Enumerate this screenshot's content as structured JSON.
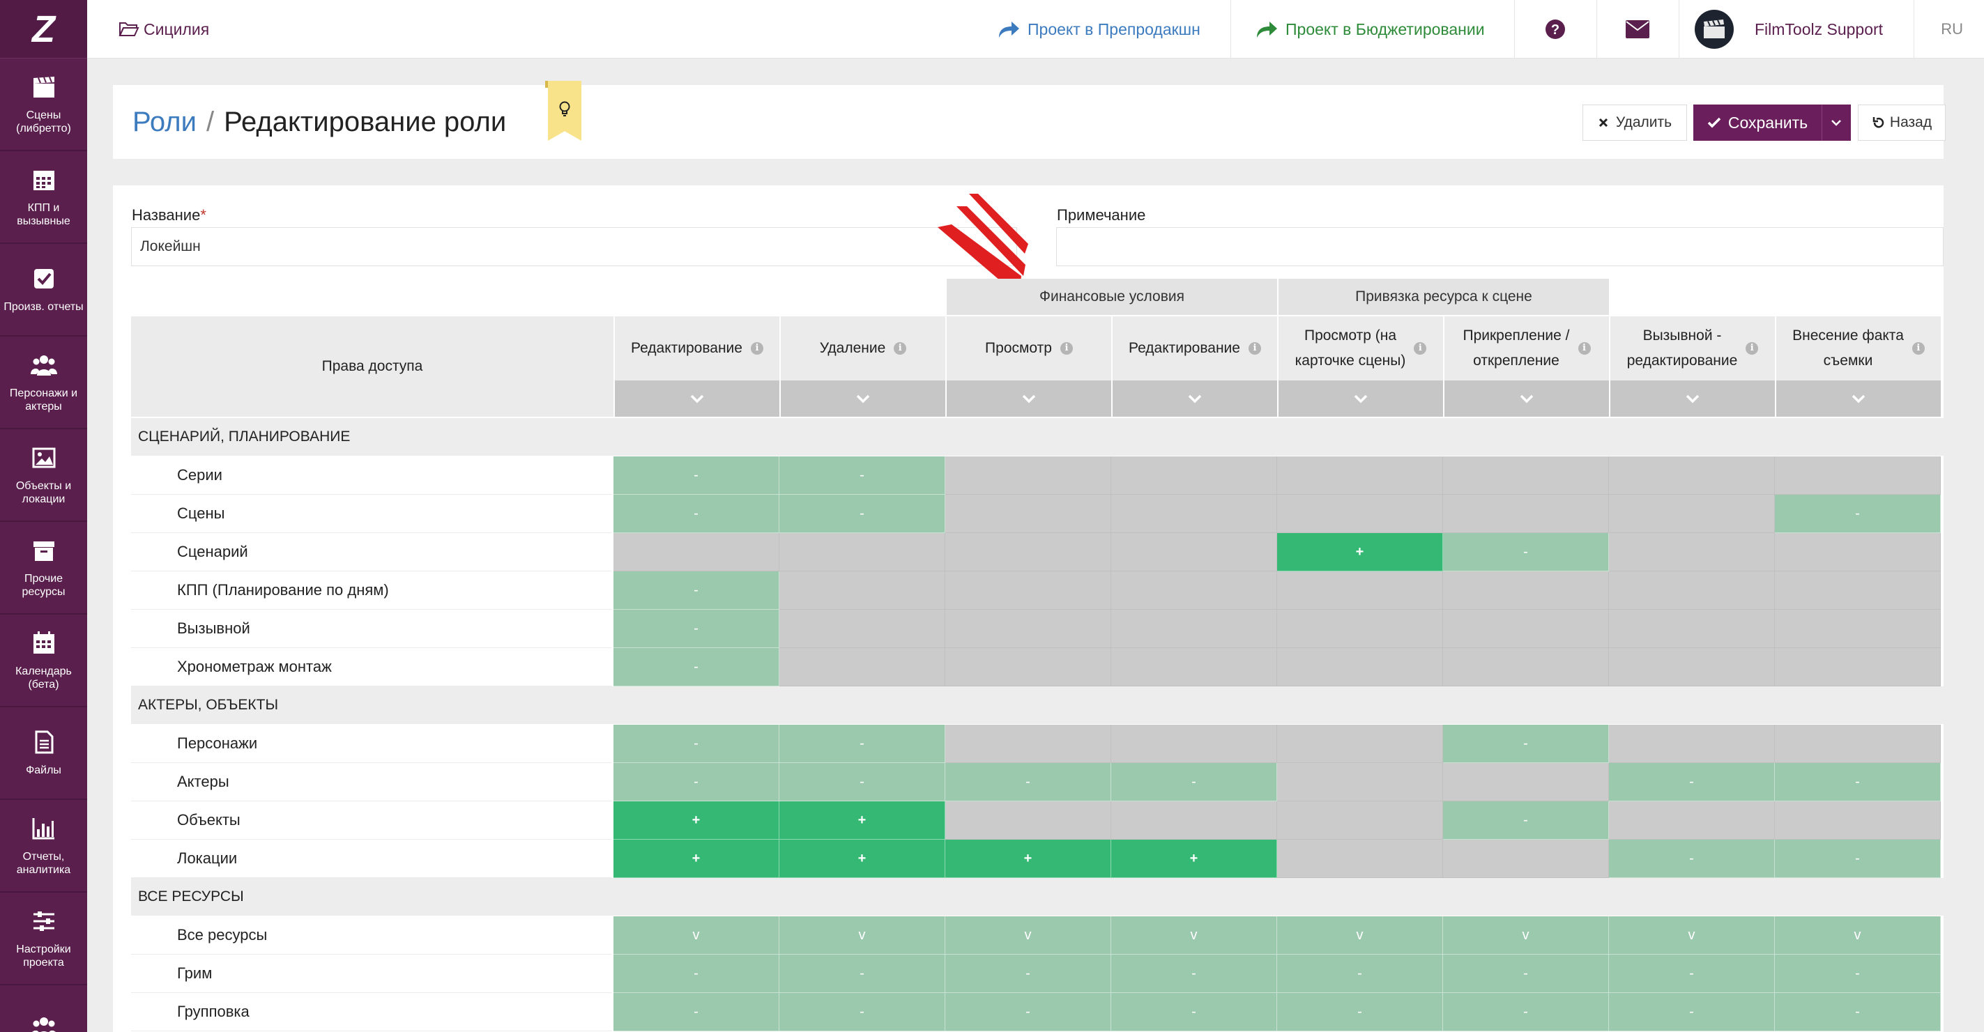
{
  "app": {
    "logo": "Z",
    "project_name": "Сицилия",
    "lang": "RU"
  },
  "topbar": {
    "link_preproduction": "Проект в Препродакшн",
    "link_budget": "Проект в Бюджетировании",
    "user_name": "FilmToolz Support"
  },
  "sidebar": {
    "items": [
      {
        "label": "Сцены (либретто)",
        "icon": "clapperboard-icon"
      },
      {
        "label": "КПП и вызывные",
        "icon": "calendar-grid-icon"
      },
      {
        "label": "Произв. отчеты",
        "icon": "checkbox-icon"
      },
      {
        "label": "Персонажи и актеры",
        "icon": "users-icon"
      },
      {
        "label": "Объекты и локации",
        "icon": "image-icon"
      },
      {
        "label": "Прочие ресурсы",
        "icon": "archive-box-icon"
      },
      {
        "label": "Календарь (бета)",
        "icon": "calendar-icon"
      },
      {
        "label": "Файлы",
        "icon": "file-icon"
      },
      {
        "label": "Отчеты, аналитика",
        "icon": "bar-chart-icon"
      },
      {
        "label": "Настройки проекта",
        "icon": "sliders-icon"
      },
      {
        "label": "",
        "icon": "users-icon"
      }
    ]
  },
  "header": {
    "breadcrumb_root": "Роли",
    "breadcrumb_sep": "/",
    "title": "Редактирование роли",
    "delete_label": "Удалить",
    "save_label": "Сохранить",
    "back_label": "Назад"
  },
  "form": {
    "name_label": "Название",
    "name_required_mark": "*",
    "name_value": "Локейшн",
    "note_label": "Примечание",
    "note_value": ""
  },
  "grid": {
    "group_headers": [
      "Финансовые условия",
      "Привязка ресурса к сцене"
    ],
    "access_header": "Права доступа",
    "columns": [
      [
        "Редактирование"
      ],
      [
        "Удаление"
      ],
      [
        "Просмотр"
      ],
      [
        "Редактирование"
      ],
      [
        "Просмотр (на",
        "карточке сцены)"
      ],
      [
        "Прикрепление /",
        "открепление"
      ],
      [
        "Вызывной -",
        "редактирование"
      ],
      [
        "Внесение факта",
        "съемки"
      ]
    ],
    "sections": [
      {
        "title": "СЦЕНАРИЙ, ПЛАНИРОВАНИЕ",
        "rows": [
          {
            "label": "Серии",
            "cells": [
              "-",
              "-",
              null,
              null,
              null,
              null,
              null,
              null
            ],
            "styles": "ggnnnnnn"
          },
          {
            "label": "Сцены",
            "cells": [
              "-",
              "-",
              null,
              null,
              null,
              null,
              null,
              "-"
            ],
            "styles": "ggnnnnng"
          },
          {
            "label": "Сценарий",
            "cells": [
              null,
              null,
              null,
              null,
              "+",
              "-",
              null,
              null
            ],
            "styles": "nnnnGgnn"
          },
          {
            "label": "КПП (Планирование по дням)",
            "cells": [
              "-",
              null,
              null,
              null,
              null,
              null,
              null,
              null
            ],
            "styles": "gnnnnnnn"
          },
          {
            "label": "Вызывной",
            "cells": [
              "-",
              null,
              null,
              null,
              null,
              null,
              null,
              null
            ],
            "styles": "gnnnnnnn"
          },
          {
            "label": "Хронометраж монтаж",
            "cells": [
              "-",
              null,
              null,
              null,
              null,
              null,
              null,
              null
            ],
            "styles": "gnnnnnnn"
          }
        ]
      },
      {
        "title": "АКТЕРЫ, ОБЪЕКТЫ",
        "rows": [
          {
            "label": "Персонажи",
            "cells": [
              "-",
              "-",
              null,
              null,
              null,
              "-",
              null,
              null
            ],
            "styles": "ggnnngnn"
          },
          {
            "label": "Актеры",
            "cells": [
              "-",
              "-",
              "-",
              "-",
              null,
              null,
              "-",
              "-"
            ],
            "styles": "ggggnngg"
          },
          {
            "label": "Объекты",
            "cells": [
              "+",
              "+",
              null,
              null,
              null,
              "-",
              null,
              null
            ],
            "styles": "GGnnngnn"
          },
          {
            "label": "Локации",
            "cells": [
              "+",
              "+",
              "+",
              "+",
              null,
              null,
              "-",
              "-"
            ],
            "styles": "GGGGnngg"
          }
        ]
      },
      {
        "title": "ВСЕ РЕСУРСЫ",
        "rows": [
          {
            "label": "Все ресурсы",
            "cells": [
              "v",
              "v",
              "v",
              "v",
              "v",
              "v",
              "v",
              "v"
            ],
            "styles": "gggggggg"
          },
          {
            "label": "Грим",
            "cells": [
              "-",
              "-",
              "-",
              "-",
              "-",
              "-",
              "-",
              "-"
            ],
            "styles": "gggggggg"
          },
          {
            "label": "Групповка",
            "cells": [
              "-",
              "-",
              "-",
              "-",
              "-",
              "-",
              "-",
              "-"
            ],
            "styles": "gggggggg"
          }
        ]
      }
    ]
  },
  "colors": {
    "sidebar": "#5b1f4e",
    "brand": "#6a1f5c",
    "link_blue": "#3d7bbf",
    "link_green": "#2e8b3a",
    "cell_green_light": "#9bc9ad",
    "cell_green_strong": "#35b874",
    "cell_disabled": "#cbcbcb",
    "annotation_arrow": "#e02020"
  }
}
